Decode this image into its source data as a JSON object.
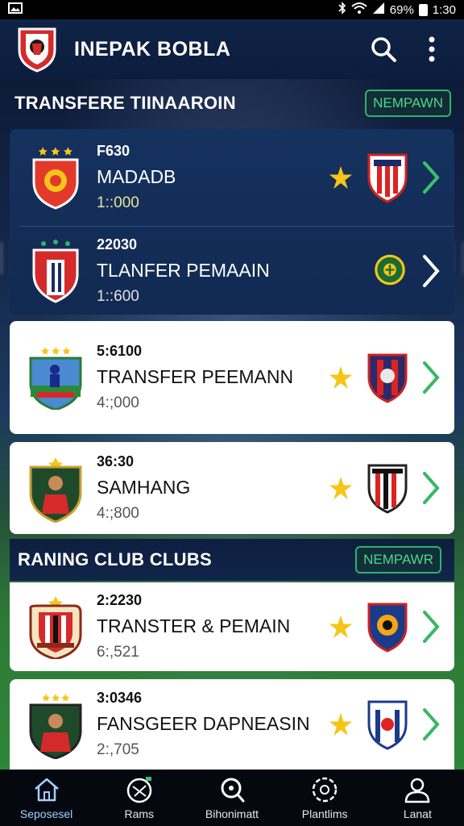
{
  "status_bar": {
    "battery": "69%",
    "time": "1:30"
  },
  "app_bar": {
    "title": "INEPAK BOBLA"
  },
  "sections": [
    {
      "title": "TRANSFERE TIINAAROIN",
      "action": "NEMPAWN"
    },
    {
      "title": "RANING CLUB CLUBS",
      "action": "NEMPAWR"
    }
  ],
  "cards": [
    {
      "time": "F630",
      "name": "MADADB",
      "sub": "1::000",
      "style": "dark",
      "favorite": true
    },
    {
      "time": "22030",
      "name": "TLANFER PEMAAIN",
      "sub": "1::600",
      "style": "dark",
      "favorite": false
    },
    {
      "time": "5:6100",
      "name": "TRANSFER PEEMANN",
      "sub": "4:;000",
      "style": "light",
      "favorite": true
    },
    {
      "time": "36:30",
      "name": "SAMHANG",
      "sub": "4:;800",
      "style": "light",
      "favorite": true
    },
    {
      "time": "2:2230",
      "name": "TRANSTER & PEMAIN",
      "sub": "6:,521",
      "style": "light",
      "favorite": true
    },
    {
      "time": "3:0346",
      "name": "FANSGEER DAPNEASIN",
      "sub": "2:,705",
      "style": "light",
      "favorite": true
    }
  ],
  "nav": [
    {
      "label": "Seposesel",
      "icon": "home-icon",
      "active": true
    },
    {
      "label": "Rams",
      "icon": "ball-icon",
      "active": false
    },
    {
      "label": "Bihonimatt",
      "icon": "search-icon",
      "active": false
    },
    {
      "label": "Plantlims",
      "icon": "badge-icon",
      "active": false
    },
    {
      "label": "Lanat",
      "icon": "profile-icon",
      "active": false
    }
  ],
  "colors": {
    "accent_green": "#2fb36a",
    "star": "#f5c518",
    "header_bg": "#0f2347"
  }
}
